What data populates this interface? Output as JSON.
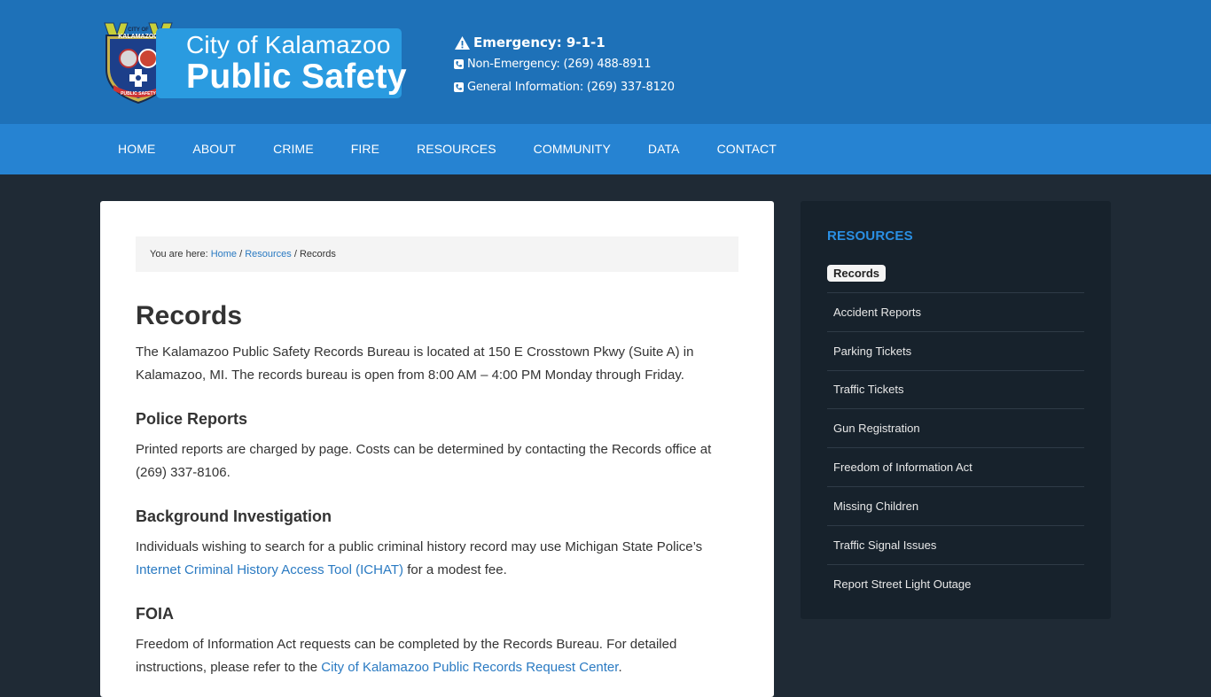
{
  "header": {
    "logo_line1": "City of Kalamazoo",
    "logo_line2": "Public Safety",
    "badge_text_top": "CITY OF KALAMAZOO",
    "badge_text_bottom": "PUBLIC SAFETY",
    "emergency": "Emergency: 9-1-1",
    "non_emergency": "Non-Emergency: (269) 488-8911",
    "general_info": "General Information: (269) 337-8120"
  },
  "nav": {
    "items": [
      "HOME",
      "ABOUT",
      "CRIME",
      "FIRE",
      "RESOURCES",
      "COMMUNITY",
      "DATA",
      "CONTACT"
    ]
  },
  "breadcrumb": {
    "prefix": "You are here: ",
    "home": "Home",
    "sep1": " / ",
    "resources": "Resources",
    "sep2": " / ",
    "current": "Records"
  },
  "main": {
    "title": "Records",
    "intro": "The Kalamazoo Public Safety Records Bureau is located at 150 E Crosstown Pkwy (Suite A) in Kalamazoo, MI. The records bureau is open from 8:00 AM – 4:00 PM Monday through Friday.",
    "sections": [
      {
        "heading": "Police Reports",
        "text": "Printed reports are charged by page. Costs can be determined by contacting the Records office at (269) 337-8106."
      },
      {
        "heading": "Background Investigation",
        "text_before": "Individuals wishing to search for a public criminal history record may use Michigan State Police’s ",
        "link": "Internet Criminal History Access Tool (ICHAT)",
        "text_after": " for a modest fee."
      },
      {
        "heading": "FOIA",
        "text_before": "Freedom of Information Act requests can be completed by the Records Bureau. For detailed instructions, please refer to the ",
        "link": "City of Kalamazoo Public Records Request Center",
        "text_after": "."
      }
    ]
  },
  "sidebar": {
    "title": "RESOURCES",
    "items": [
      "Records",
      "Accident Reports",
      "Parking Tickets",
      "Traffic Tickets",
      "Gun Registration",
      "Freedom of Information Act",
      "Missing Children",
      "Traffic Signal Issues",
      "Report Street Light Outage"
    ],
    "active_index": 0
  },
  "colors": {
    "header_bg": "#1e71b8",
    "nav_bg": "#2683d2",
    "page_bg": "#1f2a35",
    "sidebar_bg": "#17222c",
    "link": "#2a7ac2",
    "sidebar_title": "#2a8fe3"
  }
}
